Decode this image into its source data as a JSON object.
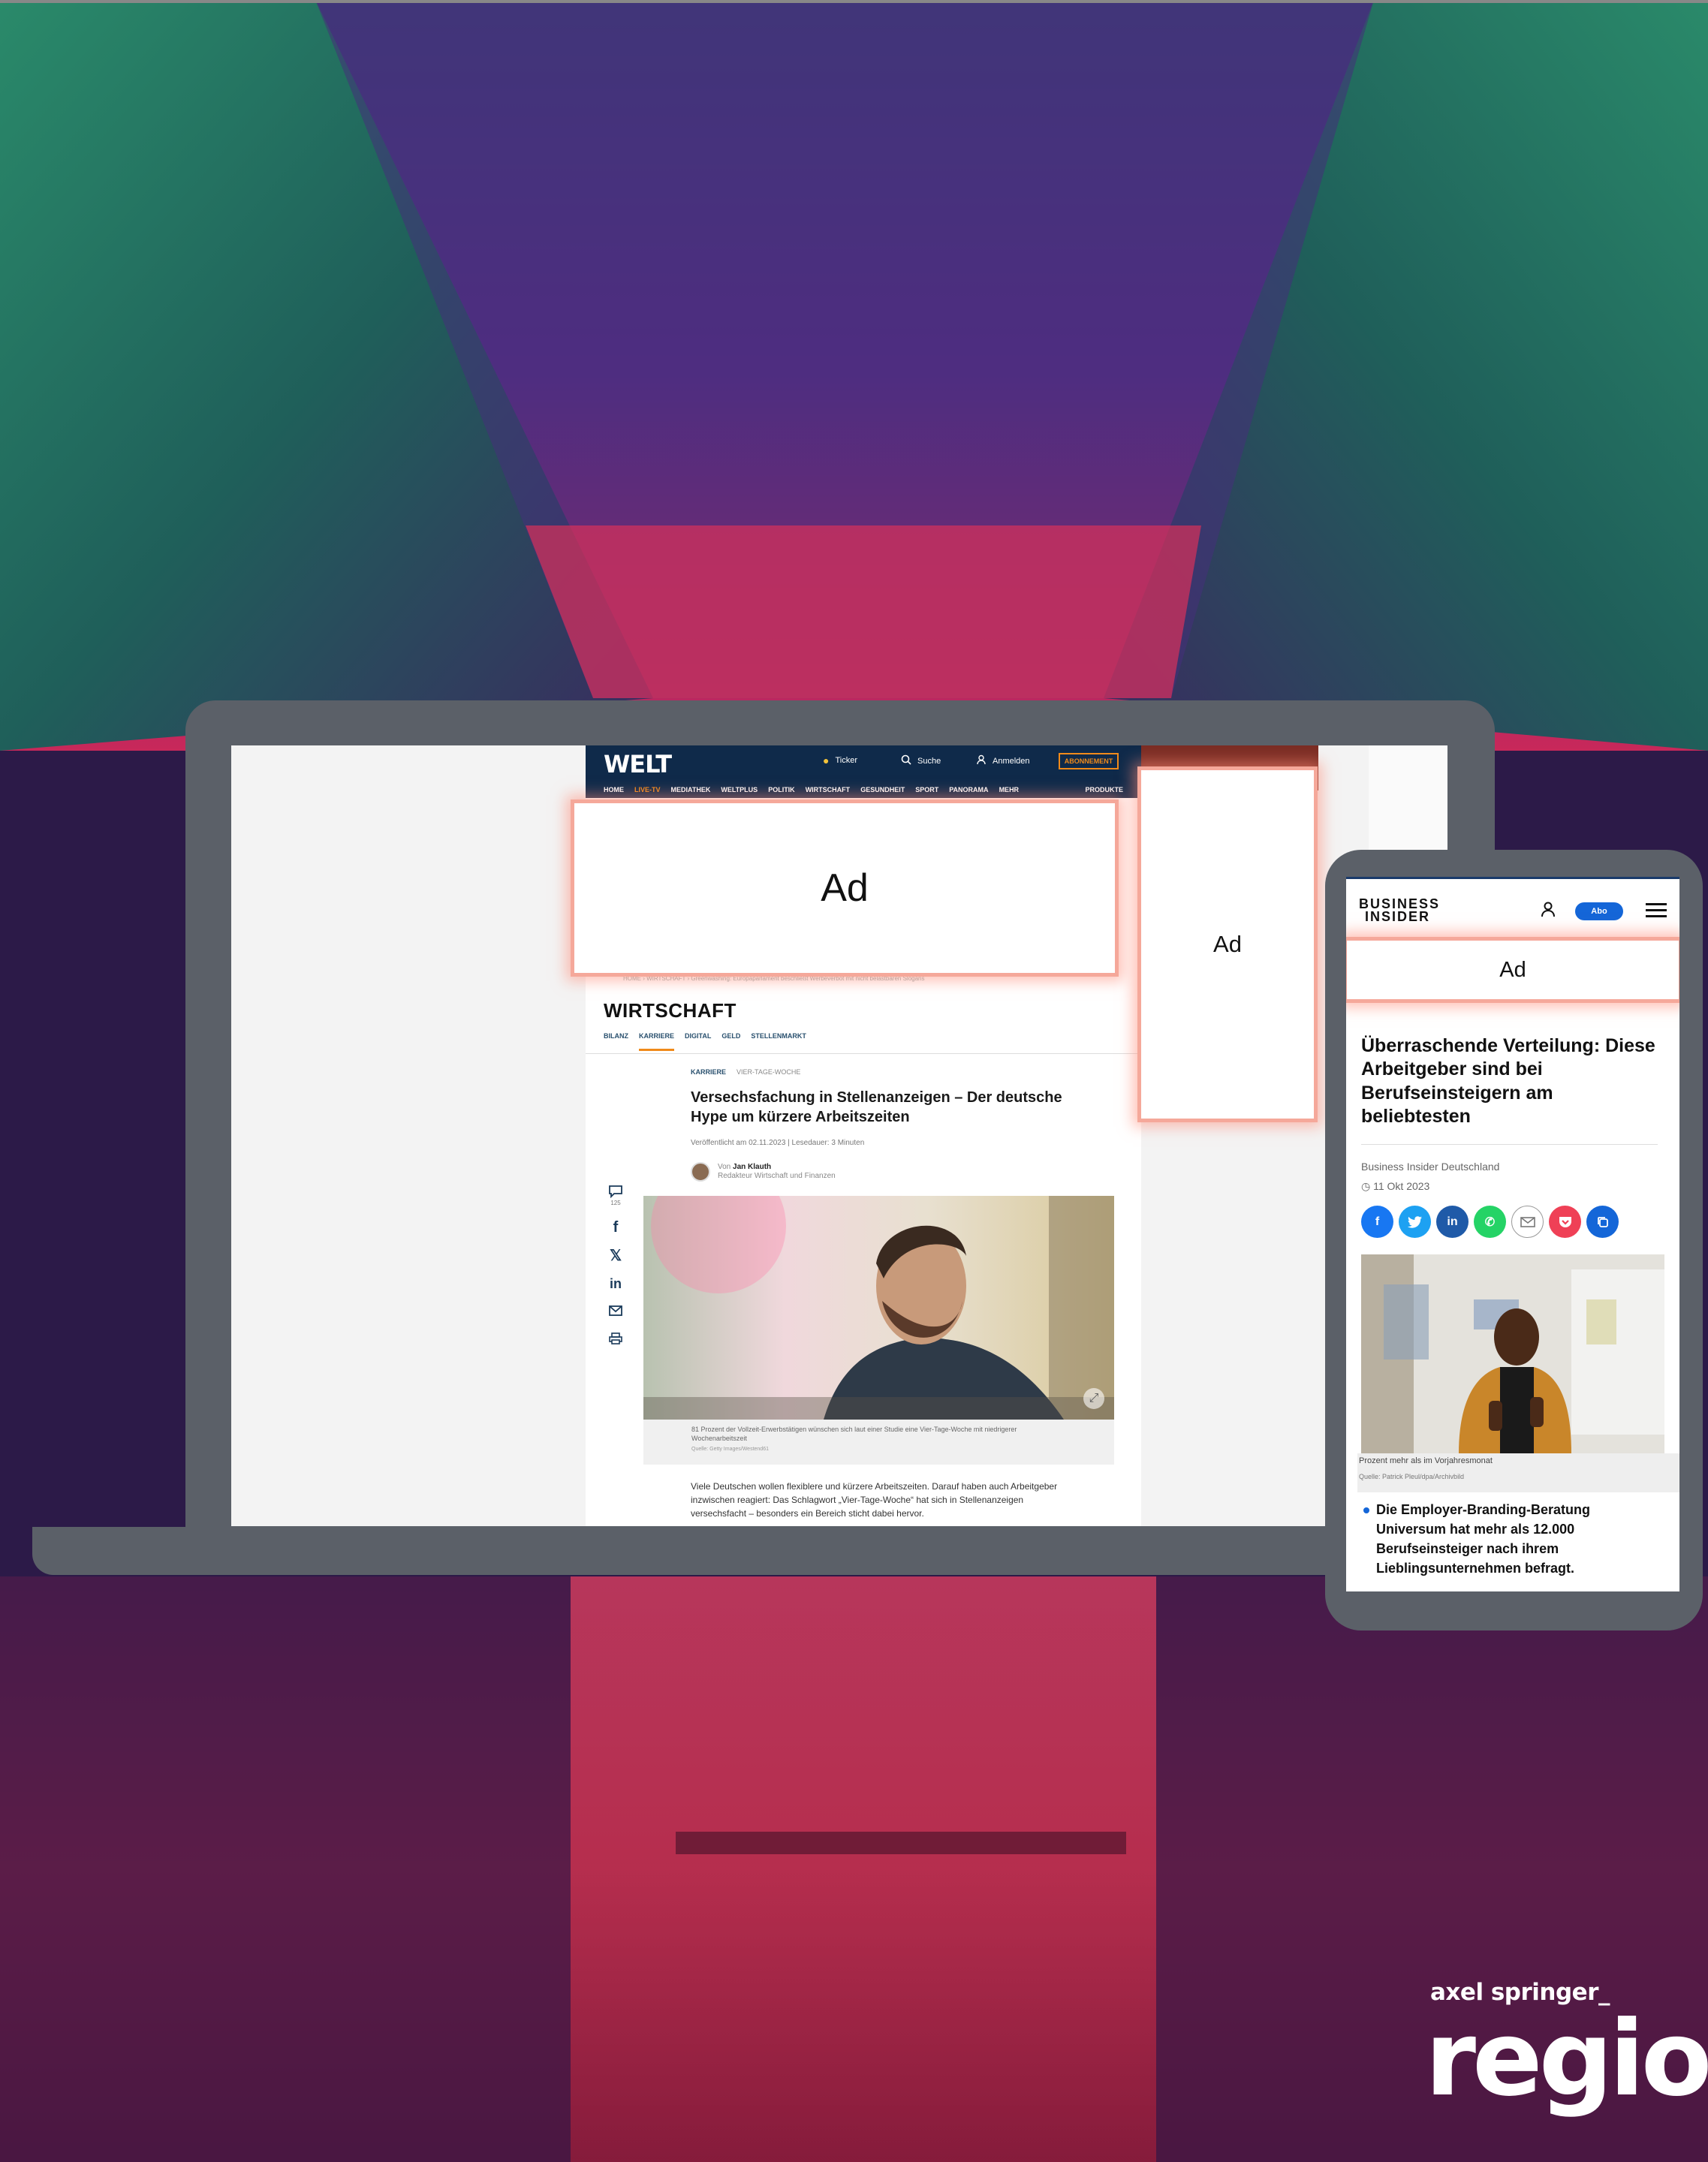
{
  "welt": {
    "logo": "WELT",
    "ticker": "Ticker",
    "search": "Suche",
    "login": "Anmelden",
    "abo": "ABONNEMENT",
    "nav": [
      "HOME",
      "LIVE-TV",
      "MEDIATHEK",
      "WELTPLUS",
      "POLITIK",
      "WIRTSCHAFT",
      "GESUNDHEIT",
      "SPORT",
      "PANORAMA",
      "MEHR",
      "PRODUKTE"
    ],
    "breadcrumb": "HOME › WIRTSCHAFT › Greenwashing: Europaparlament beschließt Werbeverbot mit nicht belastbaren Slogans",
    "section": "WIRTSCHAFT",
    "subnav": [
      "BILANZ",
      "KARRIERE",
      "DIGITAL",
      "GELD",
      "STELLENMARKT"
    ],
    "kicker": [
      "KARRIERE",
      "VIER-TAGE-WOCHE"
    ],
    "headline": "Versechsfachung in Stellenanzeigen – Der deutsche Hype um kürzere Arbeitszeiten",
    "meta": "Veröffentlicht am 02.11.2023 | Lesedauer: 3 Minuten",
    "author_prefix": "Von",
    "author_name": "Jan Klauth",
    "author_role": "Redakteur Wirtschaft und Finanzen",
    "comment_count": "125",
    "caption": "81 Prozent der Vollzeit-Erwerbstätigen wünschen sich laut einer Studie eine Vier-Tage-Woche mit niedrigerer Wochenarbeitszeit",
    "caption_source": "Quelle: Getty Images/Westend61",
    "body": "Viele Deutschen wollen flexiblere und kürzere Arbeitszeiten. Darauf haben auch Arbeitgeber inzwischen reagiert: Das Schlagwort „Vier-Tage-Woche“ hat sich in Stellenanzeigen versechsfacht – besonders ein Bereich sticht dabei hervor."
  },
  "ads": {
    "label": "Ad"
  },
  "bi": {
    "logo_line1": "BUSINESS",
    "logo_line2": "INSIDER",
    "abo": "Abo",
    "title": "Überraschende Verteilung: Diese Arbeitgeber sind bei Berufseinsteigern am beliebtesten",
    "source": "Business Insider Deutschland",
    "date": "11 Okt 2023",
    "image_caption": "Prozent mehr als im Vorjahresmonat",
    "image_source": "Quelle: Patrick Pleul/dpa/Archivbild",
    "bullet": "Die Employer-Branding-Beratung Universum hat mehr als 12.000 Berufseinsteiger nach ihrem Lieblingsunternehmen befragt.",
    "share_colors": [
      "#1877f2",
      "#1da1f2",
      "#0a66c2",
      "#25d366",
      "#ffffff",
      "#ef4056",
      "#1466d8"
    ]
  },
  "brand": {
    "line1": "axel springer_",
    "line2": "regio"
  }
}
